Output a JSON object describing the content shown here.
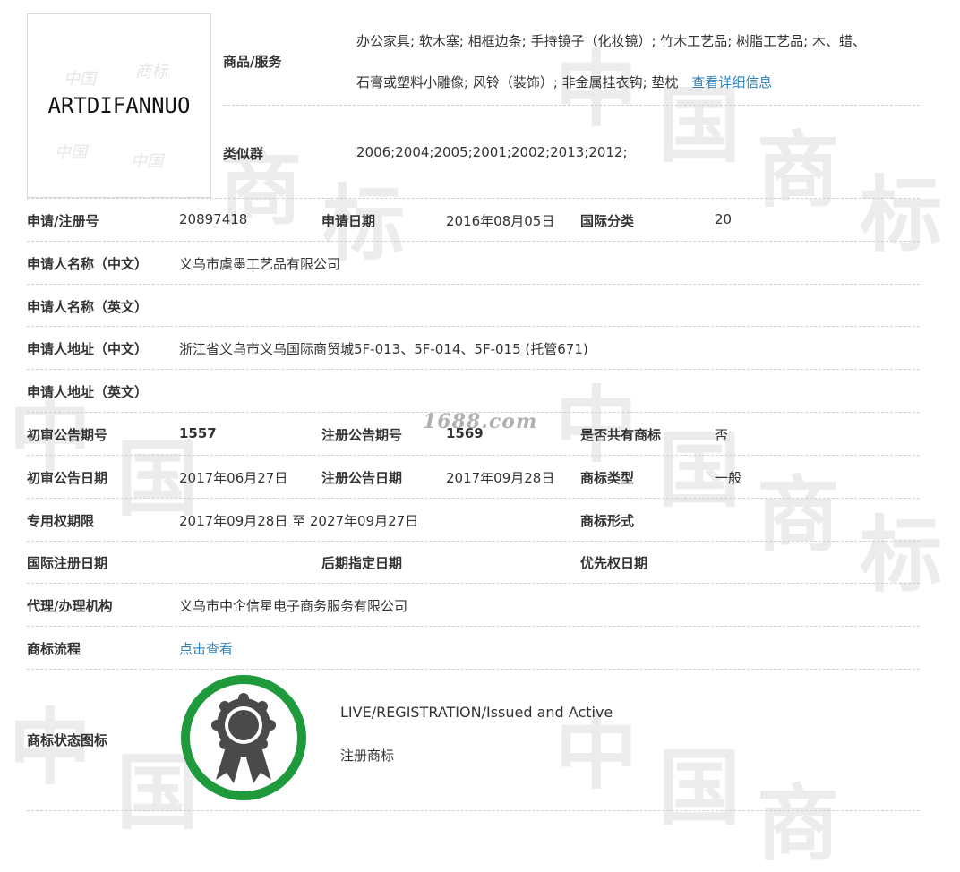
{
  "logo": {
    "text": "ARTDIFANNUO"
  },
  "goods": {
    "label": "商品/服务",
    "line1": "办公家具; 软木塞; 相框边条; 手持镜子（化妆镜）; 竹木工艺品; 树脂工艺品; 木、蜡、",
    "line2": "石膏或塑料小雕像; 风铃（装饰）; 非金属挂衣钩; 垫枕",
    "detail_link": "查看详细信息"
  },
  "similar": {
    "label": "类似群",
    "value": "2006;2004;2005;2001;2002;2013;2012;"
  },
  "rows": {
    "reg_no": {
      "label": "申请/注册号",
      "value": "20897418"
    },
    "apply_date": {
      "label": "申请日期",
      "value": "2016年08月05日"
    },
    "intl_class": {
      "label": "国际分类",
      "value": "20"
    },
    "applicant_cn": {
      "label": "申请人名称（中文）",
      "value": "义乌市虞墨工艺品有限公司"
    },
    "applicant_en": {
      "label": "申请人名称（英文）",
      "value": ""
    },
    "address_cn": {
      "label": "申请人地址（中文）",
      "value": "浙江省义乌市义乌国际商贸城5F-013、5F-014、5F-015 (托管671)"
    },
    "address_en": {
      "label": "申请人地址（英文）",
      "value": ""
    },
    "prelim_issue": {
      "label": "初审公告期号",
      "value": "1557"
    },
    "reg_issue": {
      "label": "注册公告期号",
      "value": "1569"
    },
    "shared": {
      "label": "是否共有商标",
      "value": "否"
    },
    "prelim_date": {
      "label": "初审公告日期",
      "value": "2017年06月27日"
    },
    "reg_date": {
      "label": "注册公告日期",
      "value": "2017年09月28日"
    },
    "tm_type": {
      "label": "商标类型",
      "value": "一般"
    },
    "exclusive": {
      "label": "专用权期限",
      "value": "2017年09月28日 至 2027年09月27日"
    },
    "tm_form": {
      "label": "商标形式",
      "value": ""
    },
    "intl_reg_date": {
      "label": "国际注册日期",
      "value": ""
    },
    "later_date": {
      "label": "后期指定日期",
      "value": ""
    },
    "priority_date": {
      "label": "优先权日期",
      "value": ""
    },
    "agent": {
      "label": "代理/办理机构",
      "value": "义乌市中企信星电子商务服务有限公司"
    },
    "process": {
      "label": "商标流程",
      "link": "点击查看"
    },
    "status": {
      "label": "商标状态图标",
      "line1": "LIVE/REGISTRATION/Issued and Active",
      "line2": "注册商标"
    }
  },
  "watermark": {
    "site": "1688.com"
  },
  "colors": {
    "link": "#2b7fb8",
    "badge_ring": "#1e9a3c",
    "separator": "#cfcfcf"
  },
  "icons": {
    "status": "award-ribbon-icon"
  }
}
